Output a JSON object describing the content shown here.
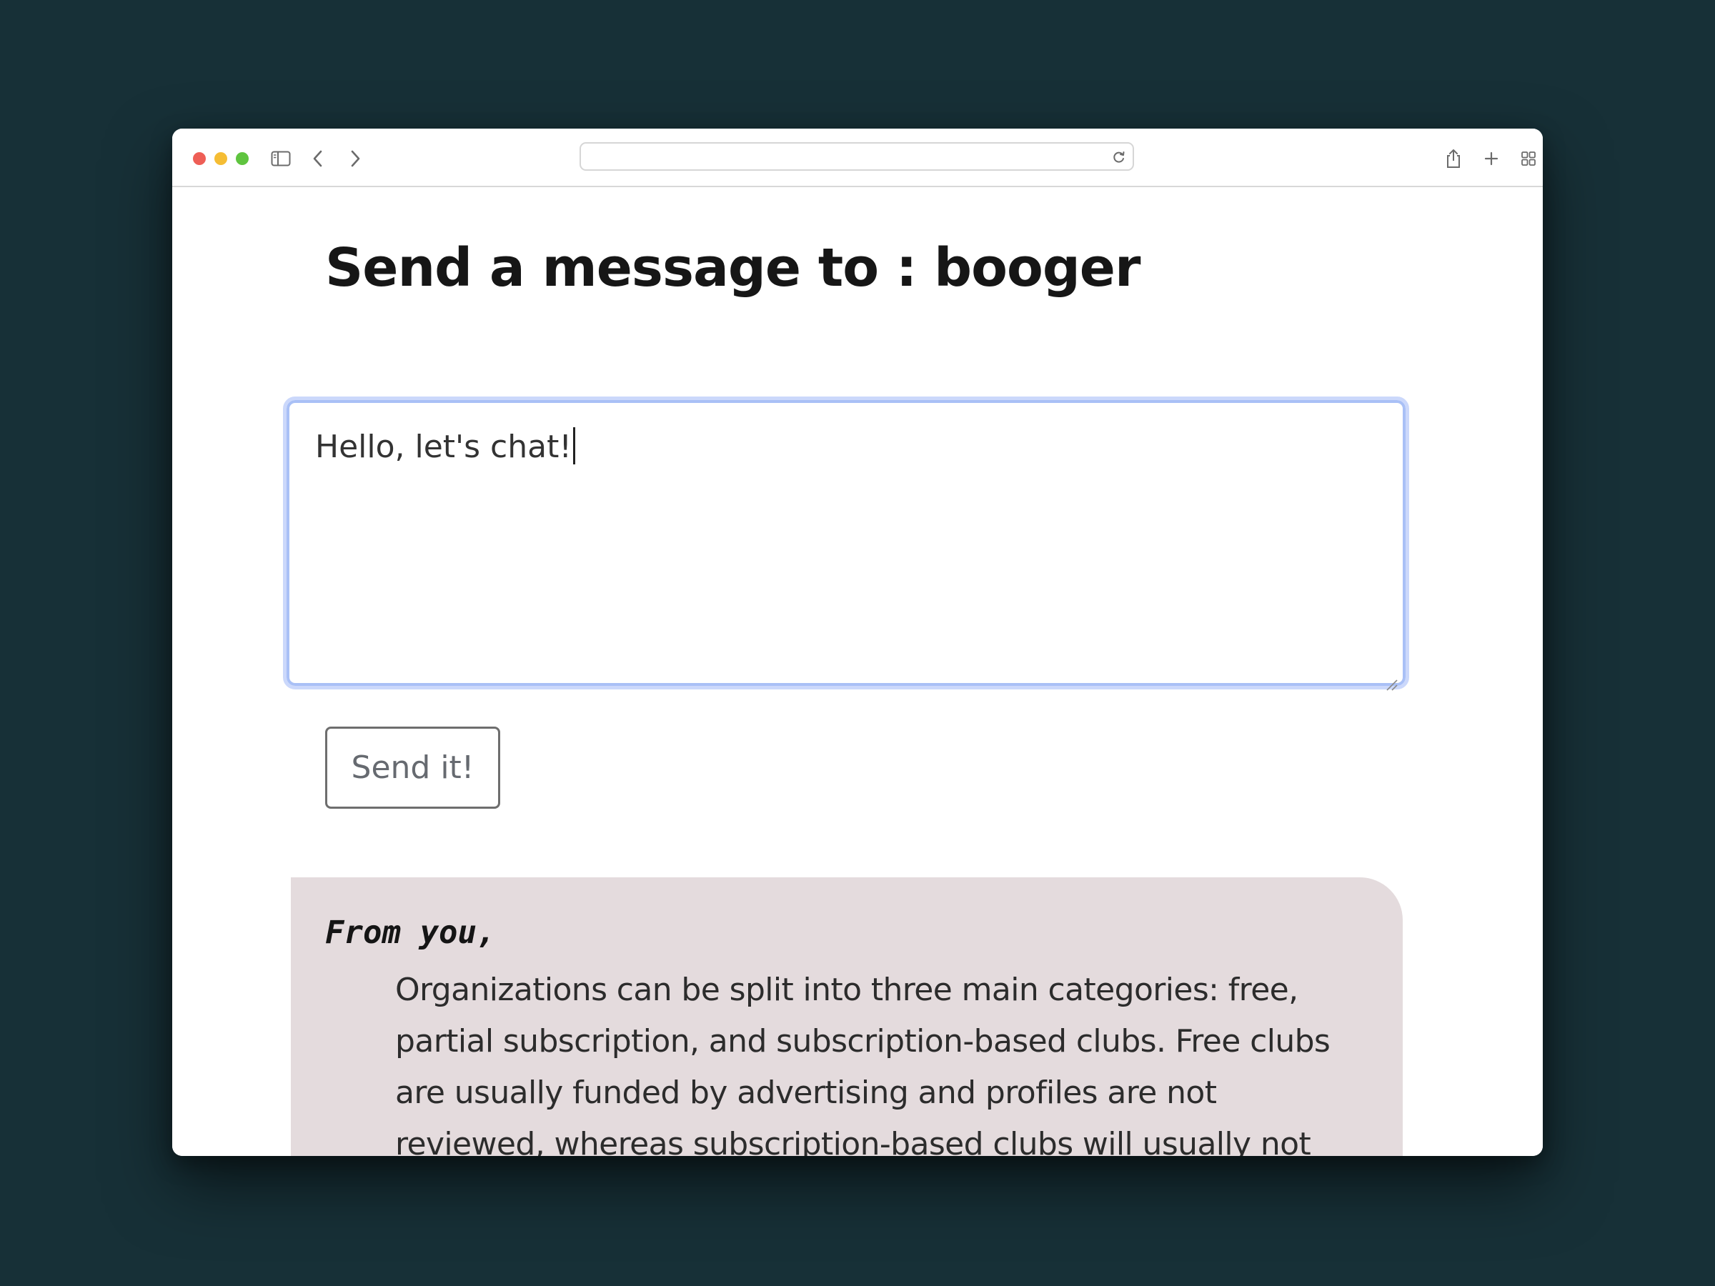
{
  "browser": {
    "address_bar_value": "",
    "icons": [
      "sidebar-icon",
      "back-icon",
      "forward-icon",
      "reload-icon",
      "share-icon",
      "new-tab-icon",
      "tab-overview-icon"
    ]
  },
  "page": {
    "title": "Send a message to : booger"
  },
  "composer": {
    "message_value": "Hello, let's chat!",
    "send_label": "Send it!",
    "focus_color": "#a9c0f6"
  },
  "messages": [
    {
      "from": "From you,",
      "body": "Organizations can be split into three main categories: free, partial subscription, and subscription-based clubs. Free clubs are usually funded by advertising and profiles are not reviewed, whereas subscription-based clubs will usually not contain any advertising and will have an administrator",
      "background": "#e4dbdd"
    }
  ]
}
